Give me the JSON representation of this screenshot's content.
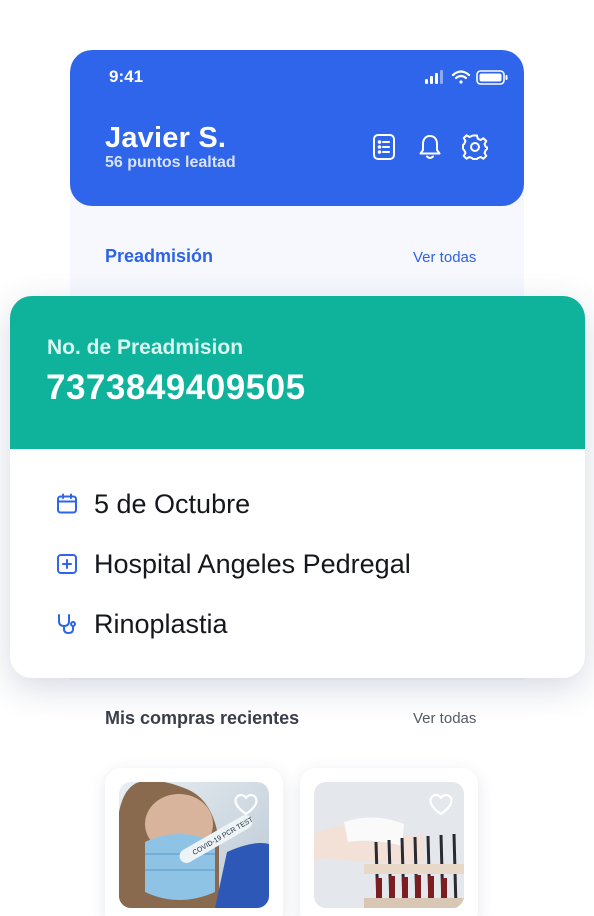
{
  "status_bar": {
    "time": "9:41"
  },
  "header": {
    "user_name": "Javier S.",
    "points": "56 puntos lealtad"
  },
  "preadmission_section": {
    "title": "Preadmisión",
    "see_all": "Ver todas"
  },
  "preadmission_card": {
    "label": "No. de Preadmision",
    "number": "7373849409505",
    "date": "5 de Octubre",
    "hospital": "Hospital Angeles Pedregal",
    "procedure": "Rinoplastia"
  },
  "purchases_section": {
    "title": "Mis compras recientes",
    "see_all": "Ver todas"
  },
  "products": [
    {
      "image_text": "COVID-19 PCR TEST"
    },
    {
      "image_text": ""
    }
  ],
  "colors": {
    "primary": "#2e65ea",
    "accent": "#0fb39c",
    "background": "#f6f8fe"
  }
}
